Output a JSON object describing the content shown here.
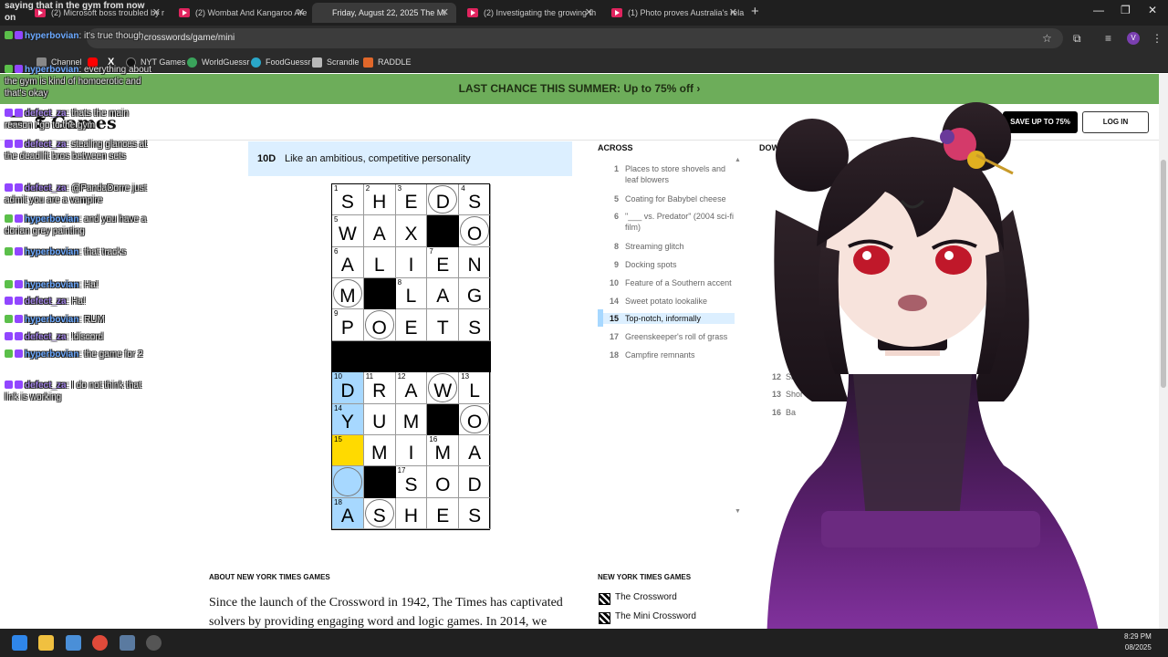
{
  "browser": {
    "tabs": [
      {
        "title": "(2) Microsoft boss troubled by r",
        "active": false
      },
      {
        "title": "(2) Wombat And Kangaroo Are",
        "active": false
      },
      {
        "title": "Friday, August 22, 2025 The Mi",
        "active": true
      },
      {
        "title": "(2) Investigating the growing th",
        "active": false
      },
      {
        "title": "(1) Photo proves Australia's rela",
        "active": false
      }
    ],
    "new_tab_label": "+",
    "url": "/crosswords/game/mini",
    "bookmarks": [
      {
        "label": "Channel",
        "color": "#888888"
      },
      {
        "label": "",
        "color": "#ff0000"
      },
      {
        "label": "",
        "color": "#000000"
      },
      {
        "label": "NYT Games",
        "color": "#111111"
      },
      {
        "label": "WorldGuessr",
        "color": "#3aa35b"
      },
      {
        "label": "FoodGuessr",
        "color": "#2aa7c9"
      },
      {
        "label": "Scrandle",
        "color": "#b8b8b8"
      },
      {
        "label": "RADDLE",
        "color": "#e0672a"
      }
    ],
    "x_glyph": "X",
    "profile_initial": "V"
  },
  "page": {
    "banner": "LAST CHANCE THIS SUMMER:  Up to 75% off ›",
    "logo": "Games",
    "save_button": "SAVE UP TO 75%",
    "login_button": "LOG IN",
    "current_clue": {
      "number": "10D",
      "text": "Like an ambitious, competitive personality"
    },
    "across_heading": "ACROSS",
    "down_heading": "DOWN",
    "across_clues": [
      {
        "num": "1",
        "text": "Places to store shovels and leaf blowers"
      },
      {
        "num": "5",
        "text": "Coating for Babybel cheese"
      },
      {
        "num": "6",
        "text": "\"___ vs. Predator\" (2004 sci-fi film)"
      },
      {
        "num": "8",
        "text": "Streaming glitch"
      },
      {
        "num": "9",
        "text": "Docking spots"
      },
      {
        "num": "10",
        "text": "Feature of a Southern accent"
      },
      {
        "num": "14",
        "text": "Sweet potato lookalike"
      },
      {
        "num": "15",
        "text": "Top-notch, informally"
      },
      {
        "num": "17",
        "text": "Greenskeeper's roll of grass"
      },
      {
        "num": "18",
        "text": "Campfire remnants"
      }
    ],
    "active_across_index": 7,
    "down_clues_visible": [
      {
        "num": "12",
        "text": "Simpl"
      },
      {
        "num": "13",
        "text": "Shor"
      },
      {
        "num": "16",
        "text": "Ba"
      }
    ],
    "footer": {
      "about_heading": "ABOUT NEW YORK TIMES GAMES",
      "about_text": "Since the launch of the Crossword in 1942, The Times has captivated solvers by providing engaging word and logic games. In 2014, we",
      "nyt_heading": "NEW YORK TIMES GAMES",
      "links": [
        "The Crossword",
        "The Mini Crossword"
      ]
    }
  },
  "crossword": {
    "cols": 5,
    "rows": 11,
    "cells": [
      [
        {
          "n": "1",
          "l": "S"
        },
        {
          "n": "2",
          "l": "H"
        },
        {
          "n": "3",
          "l": "E"
        },
        {
          "n": "",
          "l": "D",
          "c": true
        },
        {
          "n": "4",
          "l": "S"
        }
      ],
      [
        {
          "n": "5",
          "l": "W"
        },
        {
          "n": "",
          "l": "A"
        },
        {
          "n": "",
          "l": "X"
        },
        {
          "b": true
        },
        {
          "n": "",
          "l": "O",
          "c": true
        }
      ],
      [
        {
          "n": "6",
          "l": "A"
        },
        {
          "n": "",
          "l": "L"
        },
        {
          "n": "",
          "l": "I"
        },
        {
          "n": "7",
          "l": "E"
        },
        {
          "n": "",
          "l": "N"
        }
      ],
      [
        {
          "n": "",
          "l": "M",
          "c": true
        },
        {
          "b": true
        },
        {
          "n": "8",
          "l": "L"
        },
        {
          "n": "",
          "l": "A"
        },
        {
          "n": "",
          "l": "G"
        }
      ],
      [
        {
          "n": "9",
          "l": "P"
        },
        {
          "n": "",
          "l": "O",
          "c": true
        },
        {
          "n": "",
          "l": "E"
        },
        {
          "n": "",
          "l": "T"
        },
        {
          "n": "",
          "l": "S"
        }
      ],
      [
        {
          "b": true
        },
        {
          "b": true
        },
        {
          "b": true
        },
        {
          "b": true
        },
        {
          "b": true
        }
      ],
      [
        {
          "n": "10",
          "l": "D",
          "h": true
        },
        {
          "n": "11",
          "l": "R"
        },
        {
          "n": "12",
          "l": "A"
        },
        {
          "n": "",
          "l": "W",
          "c": true
        },
        {
          "n": "13",
          "l": "L"
        }
      ],
      [
        {
          "n": "14",
          "l": "Y",
          "h": true
        },
        {
          "n": "",
          "l": "U"
        },
        {
          "n": "",
          "l": "M"
        },
        {
          "b": true
        },
        {
          "n": "",
          "l": "O",
          "c": true
        }
      ],
      [
        {
          "n": "15",
          "l": "",
          "s": true
        },
        {
          "n": "",
          "l": "M"
        },
        {
          "n": "",
          "l": "I"
        },
        {
          "n": "16",
          "l": "M"
        },
        {
          "n": "",
          "l": "A"
        }
      ],
      [
        {
          "n": "",
          "l": "",
          "h": true,
          "c": true
        },
        {
          "b": true
        },
        {
          "n": "17",
          "l": "S"
        },
        {
          "n": "",
          "l": "O"
        },
        {
          "n": "",
          "l": "D"
        }
      ],
      [
        {
          "n": "18",
          "l": "A",
          "h": true
        },
        {
          "n": "",
          "l": "S",
          "c": true
        },
        {
          "n": "",
          "l": "H"
        },
        {
          "n": "",
          "l": "E"
        },
        {
          "n": "",
          "l": "S"
        }
      ]
    ]
  },
  "chat": {
    "top_text": "saying that in the gym from now on",
    "messages": [
      {
        "user": "hyperbovian",
        "text": "it's true though",
        "cls": "hyper"
      },
      {
        "user": "hyperbovian",
        "text": "everything about the gym is kind of homoerotic and that's okay",
        "cls": "hyper"
      },
      {
        "user": "defect_za",
        "text": "thats the main reason i go to the gym",
        "cls": "defect"
      },
      {
        "user": "defect_za",
        "text": "stealing glances at the deadlift bros between sets",
        "cls": "defect"
      },
      {
        "user": "defect_za",
        "text": "@PandaDorre just admit you are a vampire",
        "cls": "defect"
      },
      {
        "user": "hyperbovian",
        "text": "and you have a dorian grey painting",
        "cls": "hyper"
      },
      {
        "user": "hyperbovian",
        "text": "that tracks",
        "cls": "hyper"
      },
      {
        "user": "hyperbovian",
        "text": "Ha!",
        "cls": "hyper"
      },
      {
        "user": "defect_za",
        "text": "Ha!",
        "cls": "defect"
      },
      {
        "user": "hyperbovian",
        "text": "RUM",
        "cls": "hyper"
      },
      {
        "user": "defect_za",
        "text": "!discord",
        "cls": "defect"
      },
      {
        "user": "hyperbovian",
        "text": "the game for 2",
        "cls": "hyper"
      },
      {
        "user": "defect_za",
        "text": "I do not think that link is working",
        "cls": "defect"
      }
    ]
  },
  "taskbar": {
    "time": "8:29 PM",
    "date": "08/2025"
  }
}
